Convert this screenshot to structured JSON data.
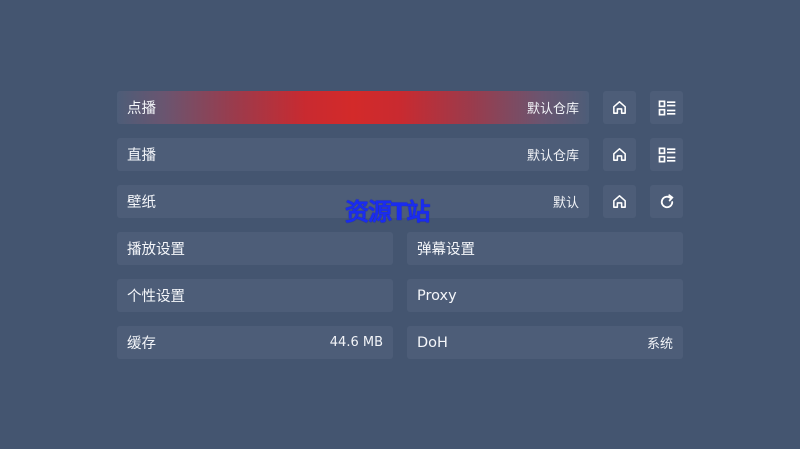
{
  "settings": {
    "vod": {
      "label": "点播",
      "value": "默认仓库"
    },
    "live": {
      "label": "直播",
      "value": "默认仓库"
    },
    "wallpaper": {
      "label": "壁纸",
      "value": "默认"
    },
    "player": {
      "label": "播放设置"
    },
    "danmaku": {
      "label": "弹幕设置"
    },
    "personal": {
      "label": "个性设置"
    },
    "proxy": {
      "label": "Proxy"
    },
    "cache": {
      "label": "缓存",
      "value": "44.6 MB"
    },
    "doh": {
      "label": "DoH",
      "value": "系统"
    }
  },
  "icons": {
    "vod_home": "home-icon",
    "vod_list": "list-icon",
    "live_home": "home-icon",
    "live_list": "list-icon",
    "wallpaper_home": "home-icon",
    "wallpaper_refresh": "refresh-icon"
  },
  "watermark": {
    "text": "资源T站"
  },
  "colors": {
    "background": "#445570",
    "card": "#4d5d78",
    "focus_accent": "#d32a2a",
    "watermark": "#1a2cf0"
  }
}
